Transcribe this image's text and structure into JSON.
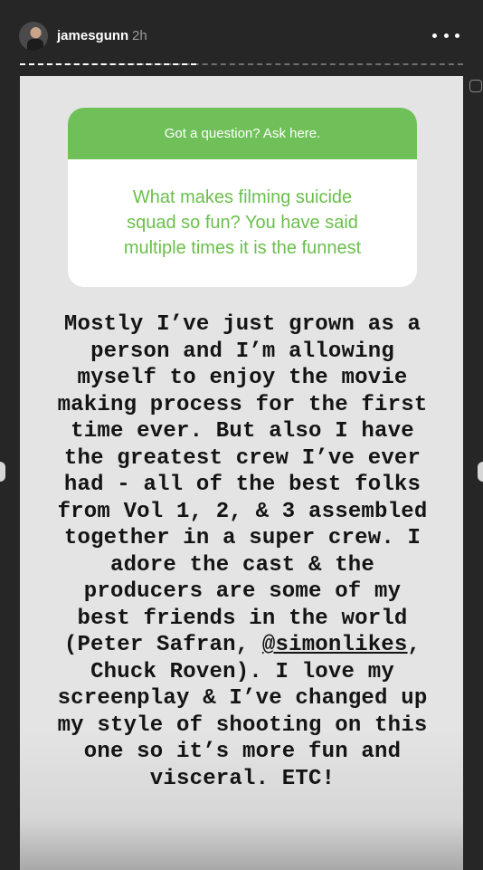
{
  "header": {
    "username": "jamesgunn",
    "timestamp": "2h",
    "more_icon": "more-horizontal-icon",
    "story_progress": 0.4
  },
  "question_sticker": {
    "prompt": "Got a question? Ask here.",
    "question_lines": [
      "What makes filming suicide",
      "squad so fun? You have said",
      "multiple times it is the funnest"
    ],
    "header_color": "#70c05a",
    "question_color": "#6abf4b"
  },
  "answer": {
    "lines": [
      "Mostly I’ve just grown as a",
      "person and I’m allowing",
      "myself to enjoy the movie",
      "making process for the first",
      "time ever. But also I have",
      "the greatest crew I’ve ever",
      "had - all of the best folks",
      "from Vol 1, 2, & 3 assembled",
      "together in a super crew. I",
      "adore the cast & the",
      "producers are some of my",
      "best friends in the world",
      "(Peter Safran, ",
      "Chuck Roven). I love my",
      "screenplay & I’ve changed up",
      "my style of shooting on this",
      "one so it’s more fun and",
      "visceral. ETC!"
    ],
    "mention": "@simonlikes",
    "mention_suffix": ","
  }
}
